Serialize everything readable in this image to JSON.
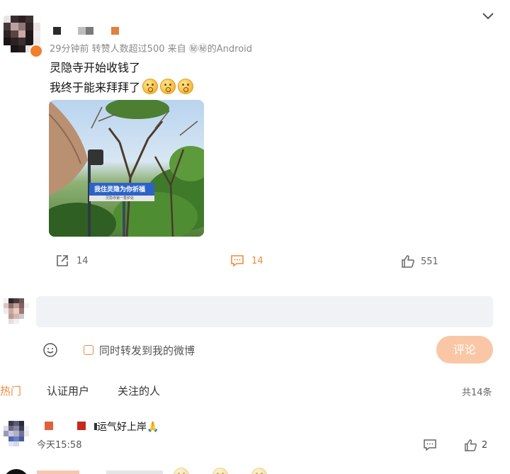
{
  "post": {
    "meta": "29分钟前 转赞人数超过500 来自 ㊙㊙的Android",
    "line1": "灵隐寺开始收钱了",
    "line2": "我终于能来拜拜了",
    "sign_text": "我住灵隐为你祈福",
    "sign_subtext": "灵隐寺第一香炉处"
  },
  "actions": {
    "repost_count": "14",
    "comment_count": "14",
    "like_count": "551"
  },
  "composer": {
    "input_placeholder": "",
    "also_repost_label": "同时转发到我的微博",
    "submit_label": "评论"
  },
  "tabs": {
    "items": [
      "热门",
      "认证用户",
      "关注的人"
    ],
    "total": "共14条"
  },
  "comment": {
    "text": "运气好上岸🙏",
    "time": "今天15:58",
    "like_count": "2"
  },
  "colors": {
    "accent": "#f08a3c",
    "button_disabled": "#f9c7a5",
    "input_bg": "#f1f2f5"
  },
  "icons": [
    "chevron-down-icon",
    "repost-icon",
    "comment-icon",
    "like-icon",
    "emoji-icon",
    "checkbox-icon",
    "reply-icon"
  ]
}
